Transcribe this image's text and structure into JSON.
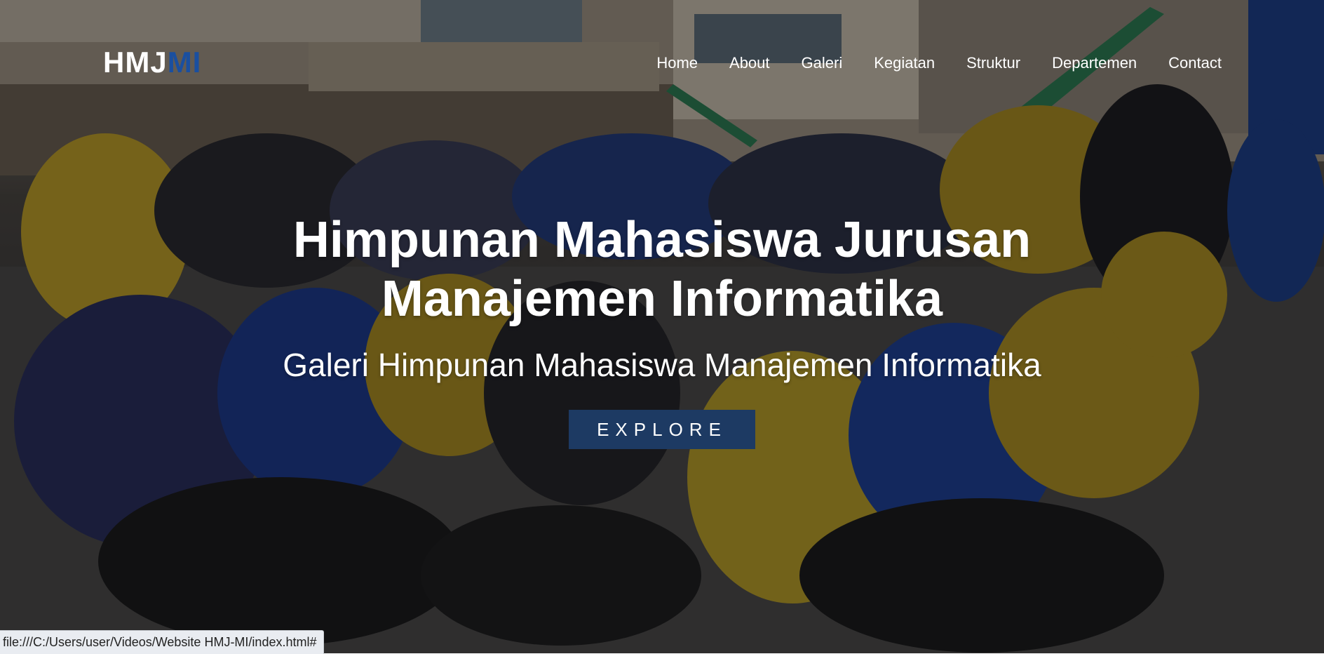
{
  "brand": {
    "logo_part1": "HMJ",
    "logo_part2": "MI",
    "logo_part1_color": "#ffffff",
    "logo_part2_color": "#1a4fa0"
  },
  "nav": {
    "items": [
      "Home",
      "About",
      "Galeri",
      "Kegiatan",
      "Struktur",
      "Departemen",
      "Contact"
    ]
  },
  "hero": {
    "title": "Himpunan Mahasiswa Jurusan Manajemen Informatika",
    "subtitle": "Galeri Himpunan Mahasiswa Manajemen Informatika",
    "button_label": "EXPLORE",
    "button_color": "#1d3a63"
  },
  "status_bar": {
    "url": "file:///C:/Users/user/Videos/Website HMJ-MI/index.html#"
  }
}
